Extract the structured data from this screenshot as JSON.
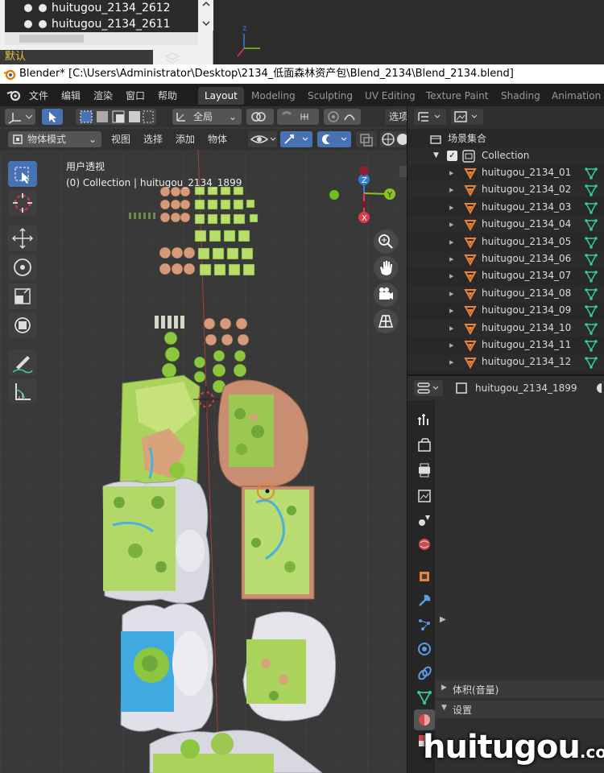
{
  "prev_window": {
    "rows": [
      "huitugou_2134_2612",
      "huitugou_2134_2611"
    ],
    "dropdown": "默认"
  },
  "titlebar": {
    "title": "Blender* [C:\\Users\\Administrator\\Desktop\\2134_低面森林资产包\\Blend_2134\\Blend_2134.blend]"
  },
  "menubar": {
    "menus": [
      "文件",
      "编辑",
      "渲染",
      "窗口",
      "帮助"
    ],
    "workspaces": [
      "Layout",
      "Modeling",
      "Sculpting",
      "UV Editing",
      "Texture Paint",
      "Shading",
      "Animation"
    ],
    "active_workspace": "Layout"
  },
  "viewport": {
    "header": {
      "transform_orientation": "全局",
      "options_label": "选项",
      "mode": "物体模式",
      "menus": [
        "视图",
        "选择",
        "添加",
        "物体"
      ]
    },
    "overlay_text": {
      "view_name": "用户透视",
      "collection_info": "(0) Collection | huitugou_2134_1899"
    },
    "gizmo": {
      "z": "Z",
      "y": "Y",
      "x": "X"
    },
    "tools": [
      "select-box-icon",
      "cursor-icon",
      "move-icon",
      "rotate-icon",
      "scale-icon",
      "transform-icon",
      "annotate-icon",
      "measure-icon"
    ],
    "nav": [
      "zoom-icon",
      "hand-icon",
      "camera-icon",
      "grid-icon"
    ]
  },
  "outliner": {
    "scene_collection": "场景集合",
    "collection": "Collection",
    "items": [
      "huitugou_2134_01",
      "huitugou_2134_02",
      "huitugou_2134_03",
      "huitugou_2134_04",
      "huitugou_2134_05",
      "huitugou_2134_06",
      "huitugou_2134_07",
      "huitugou_2134_08",
      "huitugou_2134_09",
      "huitugou_2134_10",
      "huitugou_2134_11",
      "huitugou_2134_12"
    ]
  },
  "properties": {
    "object_name": "huitugou_2134_1899",
    "sections": [
      "体积(音量)",
      "设置"
    ]
  },
  "watermark": {
    "main": "huitugou",
    "suffix": ".com"
  },
  "colors": {
    "accent_blue": "#4772b3",
    "mesh_orange": "#e8843a",
    "vertex_green": "#33cc99",
    "axis_x": "#e23a4d",
    "axis_y": "#8bc31b",
    "axis_z": "#2e7fd8"
  }
}
